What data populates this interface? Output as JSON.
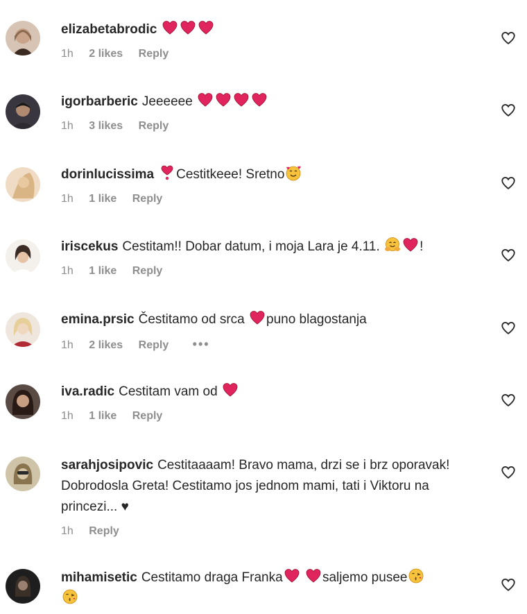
{
  "comments": [
    {
      "username": "elizabetabrodic",
      "text": "",
      "emojis_after": [
        "heart-red",
        "heart-red",
        "heart-red"
      ],
      "time": "1h",
      "likes": "2 likes",
      "reply": "Reply",
      "avatar_colors": [
        "#c9a48a",
        "#3a2a22"
      ]
    },
    {
      "username": "igorbarberic",
      "text": "Jeeeeee",
      "emojis_after": [
        "heart-red",
        "heart-red",
        "heart-red",
        "heart-red"
      ],
      "time": "1h",
      "likes": "3 likes",
      "reply": "Reply",
      "avatar_colors": [
        "#2c2a30",
        "#b08a70"
      ]
    },
    {
      "username": "dorinlucissima",
      "text_parts": [
        "",
        "Cestitkeee! Sretno",
        ""
      ],
      "emoji_before": "heart-exclamation",
      "emoji_end": "smiling-hearts",
      "time": "1h",
      "likes": "1 like",
      "reply": "Reply",
      "avatar_colors": [
        "#e8c9a0",
        "#c79a6f"
      ]
    },
    {
      "username": "iriscekus",
      "text": "Cestitam!! Dobar datum, i moja Lara je 4.11.",
      "emojis_after": [
        "hugging",
        "heart-red"
      ],
      "text_end": "!",
      "time": "1h",
      "likes": "1 like",
      "reply": "Reply",
      "avatar_colors": [
        "#f2ece6",
        "#3b2b25"
      ]
    },
    {
      "username": "emina.prsic",
      "text": "Čestitamo od srca",
      "emoji_mid": "heart-red",
      "text_end": "puno blagostanja",
      "time": "1h",
      "likes": "2 likes",
      "reply": "Reply",
      "dots": "•••",
      "avatar_colors": [
        "#f0d7c0",
        "#b22a34"
      ]
    },
    {
      "username": "iva.radic",
      "text": "Cestitam vam od",
      "emojis_after": [
        "heart-red"
      ],
      "time": "1h",
      "likes": "1 like",
      "reply": "Reply",
      "avatar_colors": [
        "#3a2a24",
        "#c99f84"
      ]
    },
    {
      "username": "sarahjosipovic",
      "text": "Cestitaaaam! Bravo mama, drzi se i brz oporavak! Dobrodosla Greta! Cestitamo jos jednom mami, tati i Viktoru na princezi... ♥",
      "time": "1h",
      "likes": "",
      "reply": "Reply",
      "avatar_colors": [
        "#d9c8a8",
        "#6b5a40"
      ]
    },
    {
      "username": "mihamisetic",
      "text": "Cestitamo draga Franka",
      "emojis_mid": [
        "heart-red",
        "heart-red"
      ],
      "text_end": "saljemo pusee",
      "emojis_end": [
        "kissing",
        "kissing"
      ],
      "avatar_colors": [
        "#2a2a2a",
        "#9a8070"
      ]
    }
  ],
  "icons": {
    "like": "heart-outline-icon"
  },
  "colors": {
    "text": "#262626",
    "meta": "#8e8e8e",
    "heart": "#e0245e"
  }
}
